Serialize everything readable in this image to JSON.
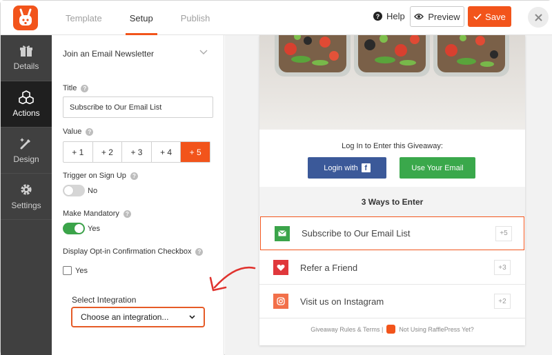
{
  "header": {
    "tabs": [
      {
        "label": "Template",
        "active": false
      },
      {
        "label": "Setup",
        "active": true
      },
      {
        "label": "Publish",
        "active": false
      }
    ],
    "help_label": "Help",
    "preview_label": "Preview",
    "save_label": "Save",
    "accent_color": "#f2541b"
  },
  "leftnav": {
    "items": [
      {
        "label": "Details",
        "icon": "gift-icon",
        "active": false
      },
      {
        "label": "Actions",
        "icon": "cubes-icon",
        "active": true
      },
      {
        "label": "Design",
        "icon": "brush-icon",
        "active": false
      },
      {
        "label": "Settings",
        "icon": "gear-icon",
        "active": false
      }
    ]
  },
  "panel": {
    "heading": "Join an Email Newsletter",
    "title_label": "Title",
    "title_value": "Subscribe to Our Email List",
    "value_label": "Value",
    "value_options": [
      "+ 1",
      "+ 2",
      "+ 3",
      "+ 4",
      "+ 5"
    ],
    "value_selected": "+ 5",
    "trigger_label": "Trigger on Sign Up",
    "trigger_state": "No",
    "mandatory_label": "Make Mandatory",
    "mandatory_state": "Yes",
    "optin_label": "Display Opt-in Confirmation Checkbox",
    "optin_option": "Yes",
    "integration_label": "Select Integration",
    "integration_value": "Choose an integration..."
  },
  "preview": {
    "login_text": "Log In to Enter this Giveaway:",
    "facebook_button": "Login with",
    "email_button": "Use Your Email",
    "ways_heading": "3 Ways to Enter",
    "entries": [
      {
        "label": "Subscribe to Our Email List",
        "points": "+5",
        "icon": "envelope-icon",
        "color": "#3ba44a",
        "selected": true
      },
      {
        "label": "Refer a Friend",
        "points": "+3",
        "icon": "heart-icon",
        "color": "#e0383c",
        "selected": false
      },
      {
        "label": "Visit us on Instagram",
        "points": "+2",
        "icon": "instagram-icon",
        "color": "#f2704a",
        "selected": false
      }
    ],
    "footer_rules": "Giveaway Rules & Terms |",
    "footer_promo": "Not Using RafflePress Yet?"
  }
}
